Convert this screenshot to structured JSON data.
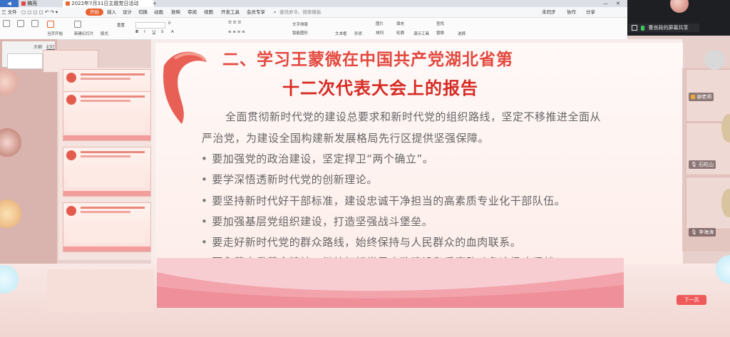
{
  "tabs": [
    {
      "label": "稿壳",
      "active": false
    },
    {
      "label": "2022年7月31日主题党日活动",
      "active": true
    }
  ],
  "menu": {
    "file": "三 文件",
    "items": [
      "开始",
      "插入",
      "设计",
      "切换",
      "动画",
      "放映",
      "审阅",
      "视图",
      "开发工具",
      "会员专享"
    ],
    "search": "查找命令、搜索模板",
    "right": [
      "未同步",
      "协作",
      "分享"
    ]
  },
  "ribbon": {
    "labels": [
      "当页开始",
      "新建幻灯片",
      "版式",
      "重置",
      "文本框",
      "形状",
      "排列",
      "轮廓",
      "演示工具",
      "替换",
      "选择",
      "查找",
      "图片",
      "填充",
      "智能图形",
      "文字排版",
      "字号"
    ],
    "font_size_value": "0"
  },
  "meeting": {
    "share_label": "曹良政的屏幕共享",
    "participants": [
      "谢老师",
      "石屹山",
      "李海涛"
    ]
  },
  "left_panel": {
    "tab_outline": "大纲",
    "tab_slides": "幻灯片"
  },
  "slide": {
    "title_line1": "二、学习王蒙微在中国共产党湖北省第",
    "title_line2": "十二次代表大会上的报告",
    "intro_line1": "全面贯彻新时代党的建设总要求和新时代党的组织路线，坚定不移推进全面从",
    "intro_line2": "严治党，为建设全国构建新发展格局先行区提供坚强保障。",
    "bullets": [
      "要加强党的政治建设，坚定捍卫“两个确立”。",
      "要学深悟透新时代党的创新理论。",
      "要坚持新时代好干部标准，建设忠诚干净担当的高素质专业化干部队伍。",
      "要加强基层党组织建设，打造坚强战斗堡垒。",
      "要走好新时代党的群众路线，始终保持与人民群众的血肉联系。",
      "要永葆自我革命精神，继续打好党风廉政建设和反腐败斗争这场攻坚战。"
    ],
    "bullet_symbol": "•"
  },
  "next_button": "下一页",
  "thumbnail_numbers": [
    "",
    "",
    "",
    ""
  ],
  "colors": {
    "title_red": "#d62a22",
    "accent_orange": "#e8622e",
    "mic_green": "#3dcb5f"
  }
}
